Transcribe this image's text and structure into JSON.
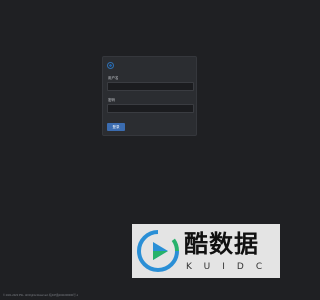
{
  "login": {
    "username_label": "用户名",
    "username_value": "",
    "password_label": "密码",
    "password_value": "",
    "submit_label": "登录"
  },
  "footer": {
    "copyright": "© 2021-2023 PSL. All Rights Reserved. 皖ICP备2021000000号-1"
  },
  "watermark": {
    "name": "酷数据",
    "sub": "KUIDC"
  },
  "colors": {
    "background": "#1f2023",
    "card": "#2b2d31",
    "accent": "#3b6cb0",
    "logo_blue": "#2a8fd6",
    "logo_green": "#27b26b"
  },
  "icons": {
    "brand": "brand-mark-icon",
    "watermark_logo": "play-logo-icon"
  }
}
